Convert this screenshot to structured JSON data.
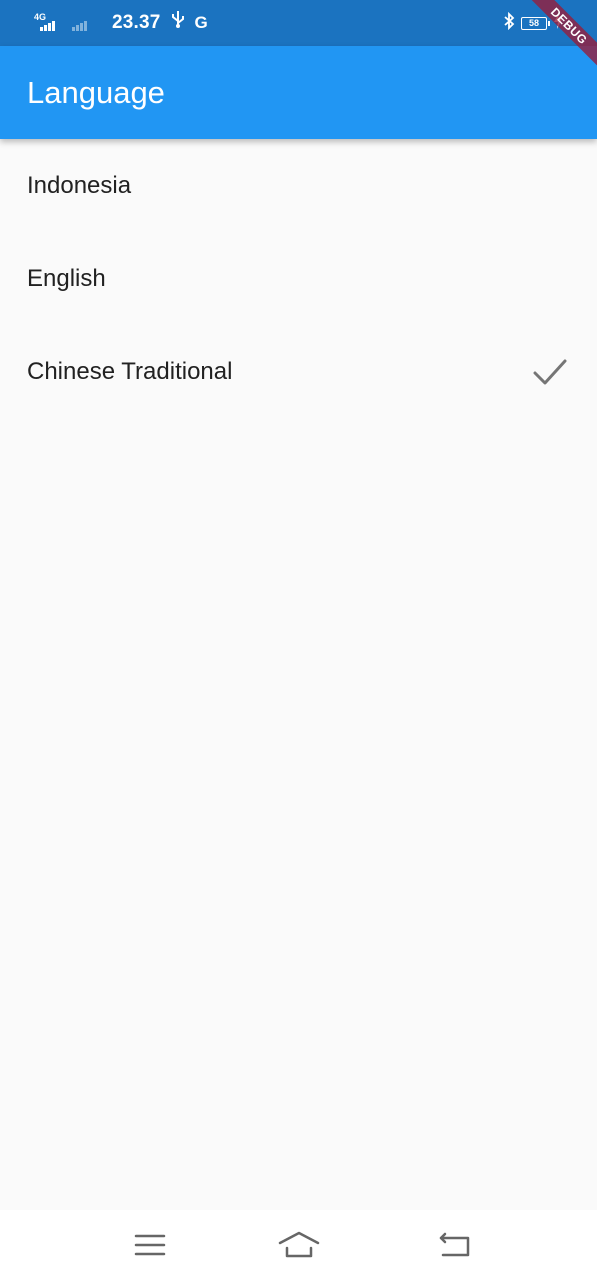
{
  "status_bar": {
    "network_type": "4G",
    "time": "23.37",
    "carrier_icon": "G",
    "battery_level": "58",
    "icons": [
      "signal-icon",
      "usb-icon",
      "bluetooth-icon",
      "battery-icon",
      "charging-icon"
    ]
  },
  "debug_banner": "DEBUG",
  "app_bar": {
    "title": "Language"
  },
  "languages": [
    {
      "label": "Indonesia",
      "selected": false
    },
    {
      "label": "English",
      "selected": false
    },
    {
      "label": "Chinese Traditional",
      "selected": true
    }
  ],
  "colors": {
    "status_bar": "#1b73c0",
    "app_bar": "#2196f3",
    "background": "#fafafa",
    "check": "#757575",
    "text": "#212121"
  },
  "nav_bar": {
    "buttons": [
      "menu-icon",
      "home-icon",
      "back-icon"
    ]
  }
}
